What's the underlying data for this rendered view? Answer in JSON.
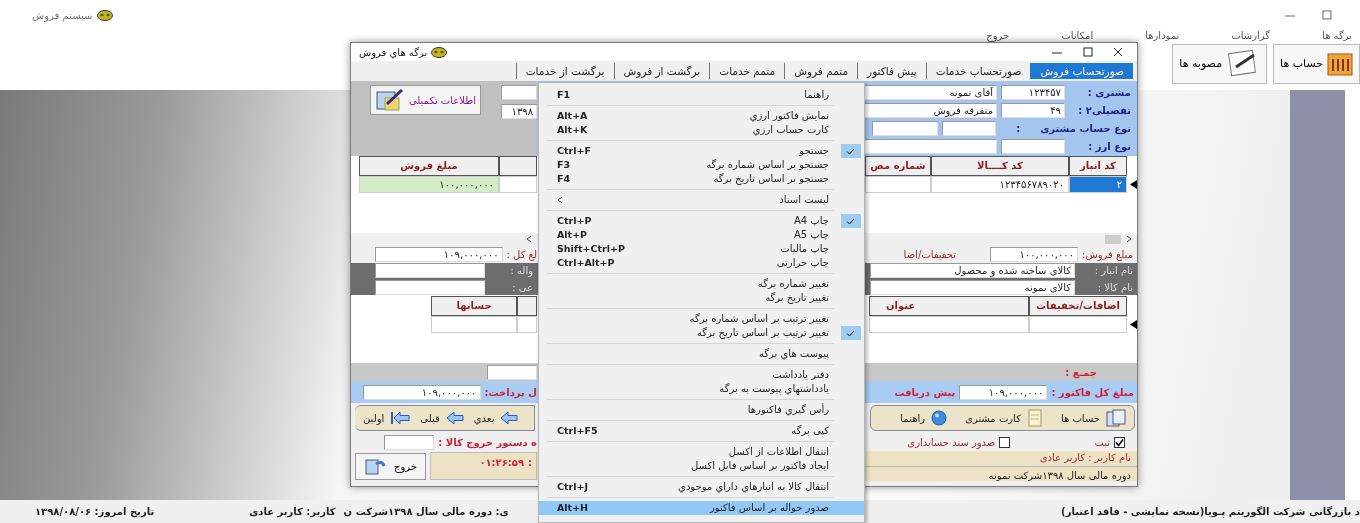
{
  "app": {
    "title": "سیستم فروش"
  },
  "menu_bar": [
    {
      "label": "برگه ها"
    },
    {
      "label": "گزارشات"
    },
    {
      "label": "نمودارها"
    },
    {
      "label": "امکانات"
    },
    {
      "label": "خروج"
    }
  ],
  "toolbar": [
    {
      "label": "حساب ها",
      "kind": "ledger"
    },
    {
      "label": "مصوبه ها",
      "kind": "approval"
    }
  ],
  "dialog": {
    "title": "برگه هاي فروش",
    "tabs": [
      {
        "label": "صورتحساب فروش",
        "selected": true
      },
      {
        "label": "صورتحساب خدمات",
        "selected": false
      },
      {
        "label": "پیش فاکتور",
        "selected": false
      },
      {
        "label": "متمم فروش",
        "selected": false
      },
      {
        "label": "متمم خدمات",
        "selected": false
      },
      {
        "label": "برگشت از فروش",
        "selected": false
      },
      {
        "label": "برگشت از خدمات",
        "selected": false
      }
    ],
    "header": {
      "info_button": "اطلاعات تکمیلی",
      "date_field": "۱۳۹۸",
      "customer_label": "مشتری :",
      "customer_code": "۱۲۳۴۵۷",
      "customer_name": "آقای نمونه",
      "detail_label": "تفصیلی۲ :",
      "detail_code": "۴۹",
      "detail_name": "متفرقه فروش",
      "account_type_label": "نوع حساب مشتری",
      "account_type_colon": ":",
      "currency_label": "نوع ارز :"
    },
    "items_grid": {
      "columns_left": [
        "مبلغ فروش"
      ],
      "columns_right": [
        "کد انبار",
        "کد کــــالا",
        "شماره مص"
      ],
      "rows": [
        {
          "sale_amount": "۱۰۰,۰۰۰,۰۰۰",
          "product_code": "۱۲۳۴۵۶۷۸۹۰۲۰",
          "warehouse_code": "۲",
          "selected": true
        }
      ]
    },
    "totals": {
      "sale_label": "مبلغ فروش:",
      "sale_value": "۱۰۰,۰۰۰,۰۰۰",
      "discount_label": "تخفیفات/اضا",
      "total_label": "لغ کل :",
      "total_value": "۱۰۹,۰۰۰,۰۰۰"
    },
    "info": {
      "warehouse_label": "نام انبار :",
      "warehouse": "کالای ساخته شده و محصول",
      "product_label": "نام کالا :",
      "product": "کالای نمونه",
      "left_labels": [
        "واله :",
        "عی :"
      ]
    },
    "adjust_grid": {
      "columns_right": [
        "اضافات/تخفیفات",
        "عنوان"
      ],
      "columns_left": [
        "حسابها"
      ]
    },
    "sum_label": "جمـع :",
    "grand": {
      "label": "مبلغ کل فاکتور :",
      "value": "۱۰۹,۰۰۰,۰۰۰",
      "prepay_label": "پیش دریافت",
      "payable_label": "ل پرداخت:",
      "payable_value": "۱۰۹,۰۰۰,۰۰۰"
    },
    "nav_right": [
      {
        "label": "حساب ها",
        "kind": "accounts"
      },
      {
        "label": "کارت مشتری",
        "kind": "card"
      },
      {
        "label": "راهنما",
        "kind": "help"
      }
    ],
    "nav_left": [
      {
        "label": "بعدي",
        "kind": "next"
      },
      {
        "label": "قبلی",
        "kind": "prev"
      },
      {
        "label": "اولین",
        "kind": "first"
      }
    ],
    "checks": [
      {
        "label": "ثبت",
        "checked": true
      },
      {
        "label": "صدور سند حسابداری",
        "checked": false
      }
    ],
    "exit_order_label": "ه دستور خروج کالا :",
    "exit_button": "خروج",
    "clock": {
      "label": ":",
      "value": "۰۱:۲۶:۵۹"
    },
    "user_line": "نام کاربر : کاربر عادی",
    "period_line": "دوره مالی سال ۱۳۹۸شرکت نمونه"
  },
  "context_menu": {
    "groups": [
      [
        {
          "label": "راهنما",
          "shortcut": "F1",
          "checked": false,
          "highlighted": false,
          "submenu": false
        }
      ],
      [
        {
          "label": "نمایش فاکتور ارزي",
          "shortcut": "Alt+A",
          "checked": false,
          "highlighted": false,
          "submenu": false
        },
        {
          "label": "کارت حساب ارزي",
          "shortcut": "Alt+K",
          "checked": false,
          "highlighted": false,
          "submenu": false
        }
      ],
      [
        {
          "label": "جستجو",
          "shortcut": "Ctrl+F",
          "checked": true,
          "highlighted": false,
          "submenu": false
        },
        {
          "label": "جستجو بر اساس شماره برگه",
          "shortcut": "F3",
          "checked": false,
          "highlighted": false,
          "submenu": false
        },
        {
          "label": "جستجو بر اساس تاريخ برگه",
          "shortcut": "F4",
          "checked": false,
          "highlighted": false,
          "submenu": false
        }
      ],
      [
        {
          "label": "لیست اسناد",
          "checked": false,
          "highlighted": false,
          "submenu": true
        }
      ],
      [
        {
          "label": "چاپ A4",
          "shortcut": "Ctrl+P",
          "checked": true,
          "highlighted": false,
          "submenu": false
        },
        {
          "label": "چاپ A5",
          "shortcut": "Alt+P",
          "checked": false,
          "highlighted": false,
          "submenu": false
        },
        {
          "label": "چاپ مالیات",
          "shortcut": "Shift+Ctrl+P",
          "checked": false,
          "highlighted": false,
          "submenu": false
        },
        {
          "label": "چاپ حرارتی",
          "shortcut": "Ctrl+Alt+P",
          "checked": false,
          "highlighted": false,
          "submenu": false
        }
      ],
      [
        {
          "label": "تغییر شماره برگه",
          "checked": false,
          "highlighted": false,
          "submenu": false
        },
        {
          "label": "تغییر تاريخ برگه",
          "checked": false,
          "highlighted": false,
          "submenu": false
        }
      ],
      [
        {
          "label": "تغییر ترتیب بر اساس شماره برگه",
          "checked": false,
          "highlighted": false,
          "submenu": false
        },
        {
          "label": "تغییر ترتیب بر اساس تاريخ برگه",
          "checked": true,
          "highlighted": false,
          "submenu": false
        }
      ],
      [
        {
          "label": "پیوست هاي برگه",
          "checked": false,
          "highlighted": false,
          "submenu": false
        }
      ],
      [
        {
          "label": "دفتر يادداشت",
          "checked": false,
          "highlighted": false,
          "submenu": false
        },
        {
          "label": "يادداشتهاي پیوست به برگه",
          "checked": false,
          "highlighted": false,
          "submenu": false
        }
      ],
      [
        {
          "label": "رأس گيري فاکتورها",
          "checked": false,
          "highlighted": false,
          "submenu": false
        }
      ],
      [
        {
          "label": "کپی برگه",
          "shortcut": "Ctrl+F5",
          "checked": false,
          "highlighted": false,
          "submenu": false
        }
      ],
      [
        {
          "label": "انتقال اطلاعات از اکسل",
          "checked": false,
          "highlighted": false,
          "submenu": false
        },
        {
          "label": "ایجاد فاکتور بر اساس فایل اکسل",
          "checked": false,
          "highlighted": false,
          "submenu": false
        }
      ],
      [
        {
          "label": "انتقال کالا به انبارهاي داراي موجودي",
          "shortcut": "Ctrl+J",
          "checked": false,
          "highlighted": false,
          "submenu": false
        }
      ],
      [
        {
          "label": "صدور حواله بر اساس فاکتور",
          "shortcut": "Alt+H",
          "checked": false,
          "highlighted": true,
          "submenu": false
        }
      ]
    ]
  },
  "status_bar": {
    "date": "تاریخ امروز: ۱۳۹۸/۰۸/۰۶",
    "user": "کاربر: کاربر عادی",
    "period": "ی: دوره مالی سال ۱۳۹۸شرکت ن",
    "company": "د بازرگانی شرکت الگوریتم پـویا(نسخه نمایشی - فاقد اعتبار)"
  }
}
